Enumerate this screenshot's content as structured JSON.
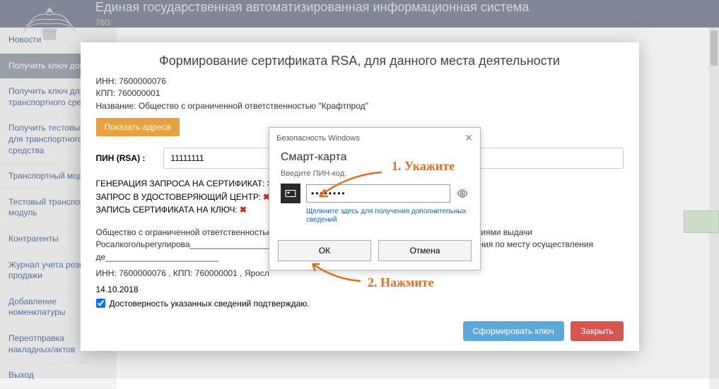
{
  "header": {
    "title": "Единая государственная автоматизированная информационная система",
    "sub_prefix": "760"
  },
  "sidebar": {
    "items": [
      {
        "label": "Новости"
      },
      {
        "label": "Получить ключ доступа"
      },
      {
        "label": "Получить ключ для транспортного средства"
      },
      {
        "label": "Получить тестовый ключ для транспортного средства"
      },
      {
        "label": "Транспортный модуль"
      },
      {
        "label": "Тестовый транспортный модуль"
      },
      {
        "label": "Контрагенты"
      },
      {
        "label": "Журнал учета розничной продажи"
      },
      {
        "label": "Добавление номенклатуры"
      },
      {
        "label": "Переотправка накладных/актов"
      },
      {
        "label": "Выход"
      }
    ]
  },
  "modal": {
    "title": "Формирование сертификата RSA, для данного места деятельности",
    "inn_label": "ИНН:",
    "inn_value": "7600000076",
    "kpp_label": "КПП:",
    "kpp_value": "760000001",
    "name_label": "Название:",
    "name_value": "Общество с ограниченной ответственностью \"Крафтпрод\"",
    "show_addresses": "Показать адреса",
    "pin_label": "ПИН (RSA) :",
    "pin_value": "11111111",
    "status1": "ГЕНЕРАЦИЯ ЗАПРОСА НА СЕРТИФИКАТ:",
    "status2": "ЗАПРОС В УДОСТОВЕРЯЮЩИЙ ЦЕНТР:",
    "status3": "ЗАПИСЬ СЕРТИФИКАТА НА КЛЮЧ:",
    "x_mark": "✖",
    "agree_text": "Общество с ограниченной ответственностью ________________________ и соглашается с Условиями выдачи Росалкогольрегулирова________________________, и просит выдать RSA-ключ для использования по месту осуществления де________________________",
    "agree_text2": "ИНН: 7600000076 , КПП: 760000001 , Яросл",
    "date": "14.10.2018",
    "checkbox_label": "Достоверность указанных сведений подтверждаю.",
    "btn_generate": "Сформировать ключ",
    "btn_close": "Закрыть"
  },
  "sec_dialog": {
    "title": "Безопасность Windows",
    "heading": "Смарт-карта",
    "sub": "Введите ПИН-код.",
    "pwd_value": "••••••••",
    "link": "Щелкните здесь для получения дополнительных сведений",
    "ok": "ОК",
    "cancel": "Отмена"
  },
  "annotations": {
    "a1": "1. Укажите",
    "a2": "2. Нажмите"
  }
}
